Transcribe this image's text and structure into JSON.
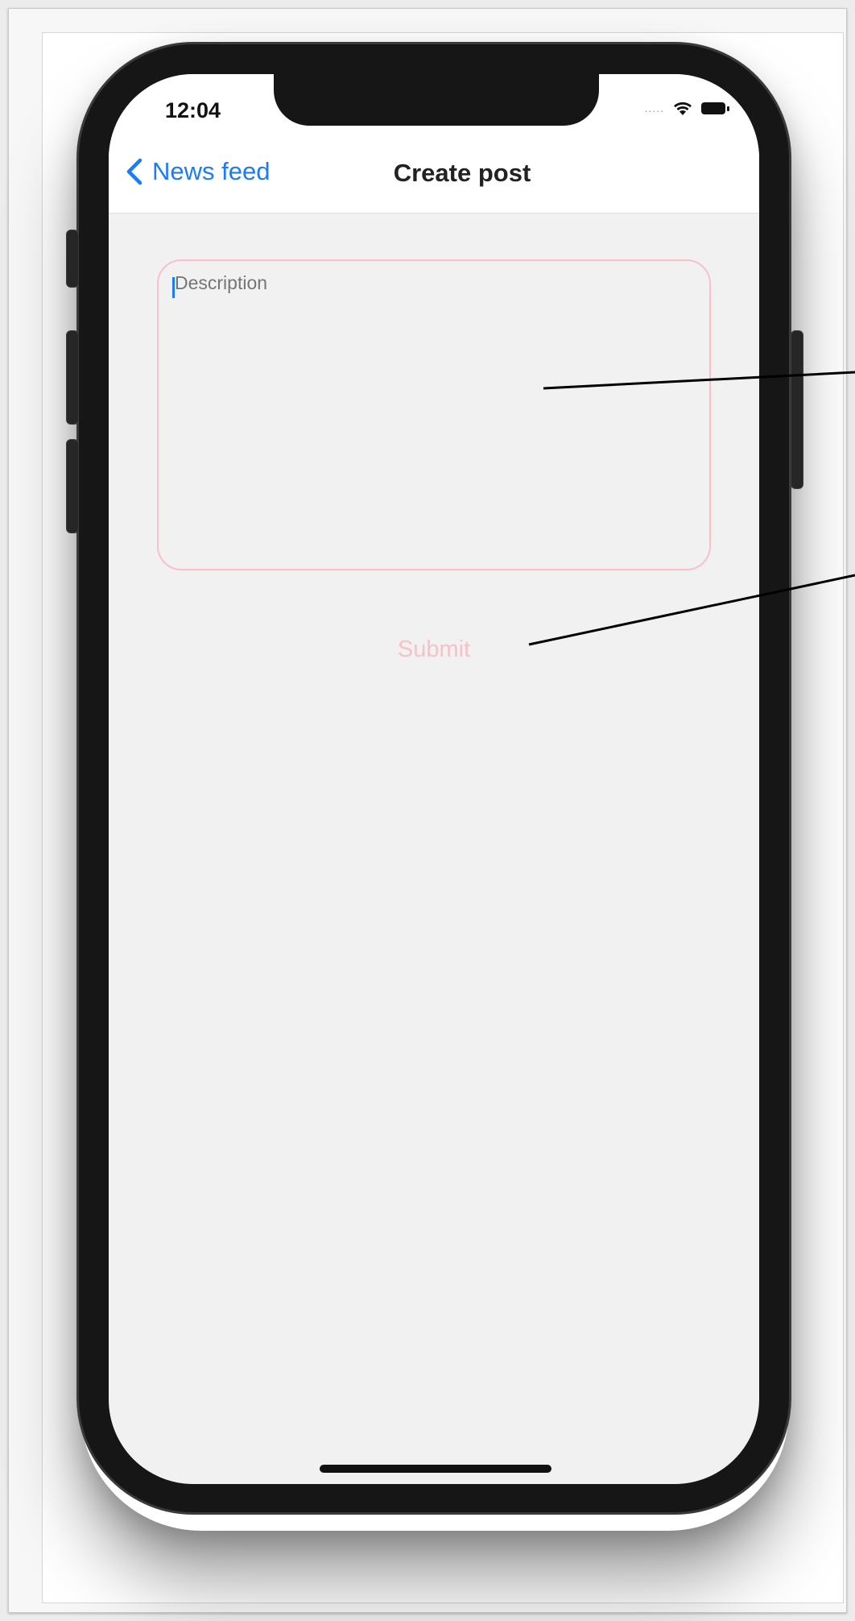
{
  "status_bar": {
    "time": "12:04",
    "signal": ".....",
    "wifi_icon": "wifi-icon",
    "battery_icon": "battery-icon"
  },
  "navbar": {
    "back_label": "News feed",
    "title": "Create post"
  },
  "form": {
    "description_placeholder": "Description",
    "submit_label": "Submit"
  },
  "colors": {
    "accent": "#1a7cf7",
    "disabled_pink": "#f7c1c9",
    "screen_bg": "#f1f1f1",
    "bezel": "#161616"
  }
}
